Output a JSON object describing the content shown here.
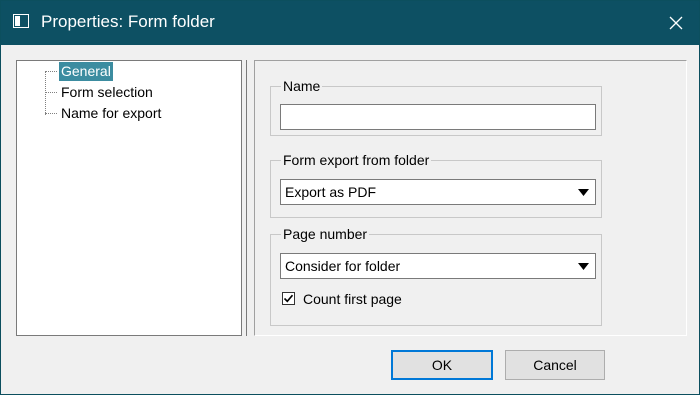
{
  "window": {
    "title": "Properties: Form folder",
    "title_icon": "window-icon",
    "close_icon": "close-icon"
  },
  "tree": {
    "items": [
      {
        "label": "General",
        "selected": true
      },
      {
        "label": "Form selection",
        "selected": false
      },
      {
        "label": "Name for export",
        "selected": false
      }
    ]
  },
  "name_group": {
    "legend": "Name",
    "value": ""
  },
  "export_group": {
    "legend": "Form export from folder",
    "selected": "Export as PDF"
  },
  "page_number_group": {
    "legend": "Page number",
    "selected": "Consider for folder",
    "checkbox_label": "Count first page",
    "checkbox_checked": true
  },
  "buttons": {
    "ok": "OK",
    "cancel": "Cancel"
  },
  "colors": {
    "titlebar": "#0d5063",
    "selection": "#3c8ca0",
    "default_button_border": "#0078d7"
  }
}
